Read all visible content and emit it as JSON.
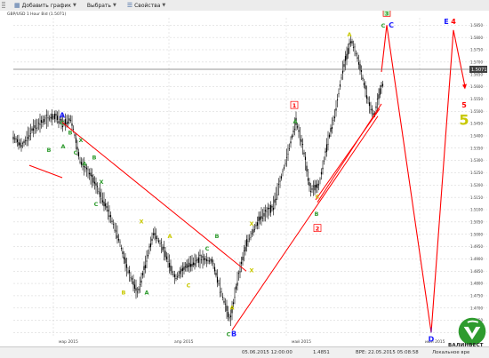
{
  "toolbar": {
    "add_chart": "Добавить график",
    "select": "Выбрать",
    "properties": "Свойства"
  },
  "chart_title": "GBP/USD 1 Hour Bid (1.5071)",
  "price_flag": "1.5071",
  "status_bar": {
    "date": "05.06.2015 12:00:00",
    "price": "1.4851",
    "gmt": "ВРЕ: 22.05.2015 05:08:58",
    "local": "Локальное вре"
  },
  "logo_text": "ВАЛИНВЕСТ",
  "colors": {
    "candle": "#000000",
    "trend_line": "#ff0000",
    "grid": "#cfcfcf",
    "wave_green": "#2e9b2e",
    "wave_blue": "#1a1aff",
    "wave_red": "#ff0000",
    "wave_yellow": "#c8c800"
  },
  "chart_data": {
    "type": "candlestick",
    "instrument": "GBP/USD",
    "timeframe": "1 Hour",
    "x_ticks": [
      "мар 2015",
      "апр 2015",
      "май 2015",
      "июн 2015"
    ],
    "y_ticks": [
      "1.5850",
      "1.5800",
      "1.5750",
      "1.5700",
      "1.5650",
      "1.5600",
      "1.5550",
      "1.5500",
      "1.5450",
      "1.5400",
      "1.5350",
      "1.5300",
      "1.5250",
      "1.5200",
      "1.5150",
      "1.5100",
      "1.5050",
      "1.5000",
      "1.4950",
      "1.4900",
      "1.4850",
      "1.4800",
      "1.4750",
      "1.4700",
      "1.4650",
      "1.4600"
    ],
    "ylim": [
      1.458,
      1.588
    ],
    "price_anchors": [
      [
        0,
        1.5395
      ],
      [
        10,
        1.536
      ],
      [
        22,
        1.543
      ],
      [
        35,
        1.5465
      ],
      [
        48,
        1.548
      ],
      [
        56,
        1.545
      ],
      [
        65,
        1.547
      ],
      [
        75,
        1.53
      ],
      [
        90,
        1.522
      ],
      [
        105,
        1.511
      ],
      [
        118,
        1.499
      ],
      [
        128,
        1.486
      ],
      [
        140,
        1.476
      ],
      [
        148,
        1.487
      ],
      [
        158,
        1.501
      ],
      [
        170,
        1.493
      ],
      [
        182,
        1.482
      ],
      [
        194,
        1.487
      ],
      [
        210,
        1.49
      ],
      [
        224,
        1.489
      ],
      [
        236,
        1.474
      ],
      [
        244,
        1.465
      ],
      [
        252,
        1.481
      ],
      [
        262,
        1.496
      ],
      [
        278,
        1.507
      ],
      [
        292,
        1.511
      ],
      [
        306,
        1.529
      ],
      [
        318,
        1.546
      ],
      [
        326,
        1.535
      ],
      [
        334,
        1.518
      ],
      [
        344,
        1.52
      ],
      [
        354,
        1.538
      ],
      [
        362,
        1.549
      ],
      [
        370,
        1.566
      ],
      [
        380,
        1.579
      ],
      [
        387,
        1.572
      ],
      [
        392,
        1.565
      ],
      [
        400,
        1.553
      ],
      [
        406,
        1.548
      ],
      [
        412,
        1.5575
      ],
      [
        416,
        1.5615
      ]
    ],
    "trend_lines": [
      {
        "from": [
          18,
          1.528
        ],
        "to": [
          55,
          1.523
        ]
      },
      {
        "from": [
          55,
          1.5455
        ],
        "to": [
          262,
          1.485
        ]
      },
      {
        "from": [
          246,
          1.461
        ],
        "to": [
          410,
          1.548
        ]
      },
      {
        "from": [
          340,
          1.514
        ],
        "to": [
          412,
          1.551
        ]
      },
      {
        "from": [
          342,
          1.513
        ],
        "to": [
          414,
          1.553
        ]
      }
    ],
    "projection_path": [
      [
        414,
        1.566
      ],
      [
        420,
        1.585
      ],
      [
        470,
        1.46
      ],
      [
        495,
        1.583
      ],
      [
        508,
        1.56
      ]
    ],
    "labels": [
      {
        "text": "A",
        "x": 55,
        "y": 1.548,
        "color": "blue"
      },
      {
        "text": "C",
        "x": 55,
        "y": 1.545,
        "color": "green"
      },
      {
        "text": "B",
        "x": 40,
        "y": 1.534,
        "color": "green"
      },
      {
        "text": "B",
        "x": 64,
        "y": 1.541,
        "color": "green"
      },
      {
        "text": "X",
        "x": 76,
        "y": 1.538,
        "color": "green"
      },
      {
        "text": "A",
        "x": 56,
        "y": 1.5355,
        "color": "green"
      },
      {
        "text": "C",
        "x": 70,
        "y": 1.533,
        "color": "green"
      },
      {
        "text": "A",
        "x": 80,
        "y": 1.5285,
        "color": "green"
      },
      {
        "text": "B",
        "x": 91,
        "y": 1.531,
        "color": "green"
      },
      {
        "text": "X",
        "x": 99,
        "y": 1.521,
        "color": "green"
      },
      {
        "text": "C",
        "x": 93,
        "y": 1.512,
        "color": "green"
      },
      {
        "text": "A",
        "x": 150,
        "y": 1.476,
        "color": "green"
      },
      {
        "text": "A",
        "x": 176,
        "y": 1.499,
        "color": "yellow"
      },
      {
        "text": "C",
        "x": 218,
        "y": 1.494,
        "color": "green"
      },
      {
        "text": "B",
        "x": 229,
        "y": 1.499,
        "color": "green"
      },
      {
        "text": "X",
        "x": 144,
        "y": 1.505,
        "color": "yellow"
      },
      {
        "text": "C",
        "x": 197,
        "y": 1.479,
        "color": "yellow"
      },
      {
        "text": "B",
        "x": 124,
        "y": 1.476,
        "color": "yellow"
      },
      {
        "text": "X",
        "x": 268,
        "y": 1.504,
        "color": "yellow"
      },
      {
        "text": "B",
        "x": 248,
        "y": 1.459,
        "color": "blue"
      },
      {
        "text": "C",
        "x": 242,
        "y": 1.459,
        "color": "green"
      },
      {
        "text": "A",
        "x": 246,
        "y": 1.47,
        "color": "yellow"
      },
      {
        "text": "X",
        "x": 268,
        "y": 1.485,
        "color": "yellow"
      },
      {
        "text": "1",
        "x": 316,
        "y": 1.552,
        "color": "red-box"
      },
      {
        "text": "A",
        "x": 317,
        "y": 1.5455,
        "color": "green"
      },
      {
        "text": "2",
        "x": 342,
        "y": 1.502,
        "color": "red-box"
      },
      {
        "text": "B",
        "x": 341,
        "y": 1.508,
        "color": "green"
      },
      {
        "text": "C",
        "x": 342,
        "y": 1.515,
        "color": "yellow"
      },
      {
        "text": "A",
        "x": 378,
        "y": 1.581,
        "color": "yellow"
      },
      {
        "text": "3",
        "x": 420,
        "y": 1.5895,
        "color": "green-box"
      },
      {
        "text": "C",
        "x": 416,
        "y": 1.5845,
        "color": "green"
      },
      {
        "text": "C",
        "x": 425,
        "y": 1.5845,
        "color": "blue"
      },
      {
        "text": "E",
        "x": 487,
        "y": 1.586,
        "color": "blue"
      },
      {
        "text": "4",
        "x": 495,
        "y": 1.586,
        "color": "red"
      },
      {
        "text": "5",
        "x": 507,
        "y": 1.552,
        "color": "red"
      },
      {
        "text": "5",
        "x": 507,
        "y": 1.545,
        "color": "yellow-big"
      },
      {
        "text": "D",
        "x": 470,
        "y": 1.457,
        "color": "blue"
      }
    ]
  }
}
